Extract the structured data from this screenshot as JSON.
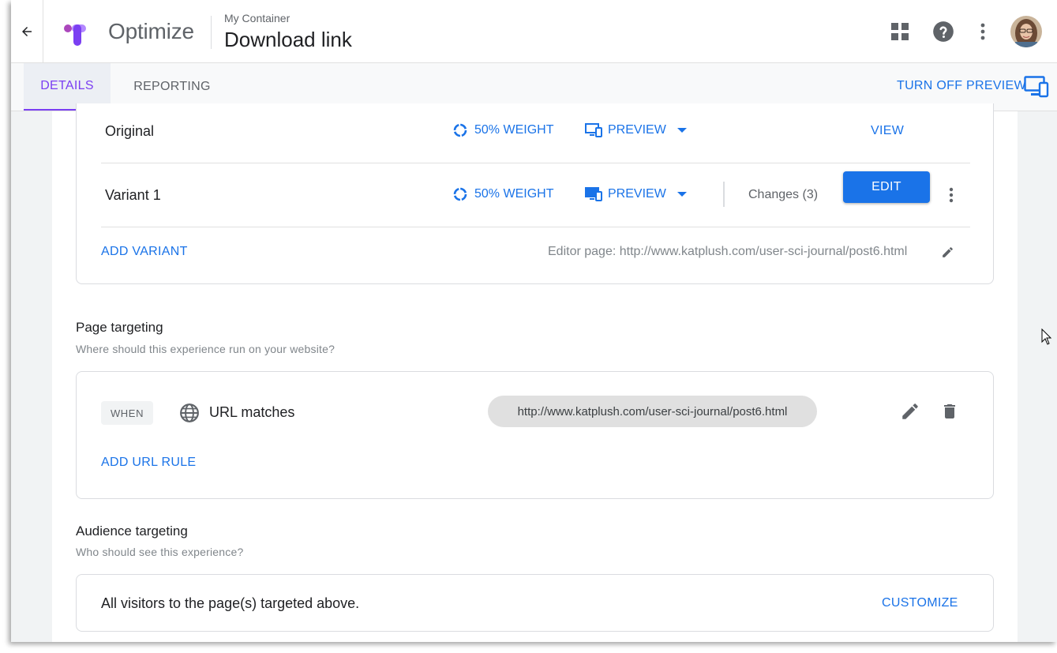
{
  "header": {
    "product_name": "Optimize",
    "container_name": "My Container",
    "experience_name": "Download link",
    "icons": [
      "arrow-back-icon",
      "apps-grid-icon",
      "help-icon",
      "more-vert-icon",
      "avatar"
    ]
  },
  "tabs": [
    {
      "label": "DETAILS",
      "active": true
    },
    {
      "label": "REPORTING",
      "active": false
    }
  ],
  "toolbar": {
    "turn_off_preview": "TURN OFF PREVIEW"
  },
  "variants": {
    "items": [
      {
        "name": "Original",
        "weight": "50% WEIGHT",
        "preview": "PREVIEW",
        "action": "VIEW"
      },
      {
        "name": "Variant 1",
        "weight": "50% WEIGHT",
        "preview": "PREVIEW",
        "changes": "Changes (3)",
        "action": "EDIT"
      }
    ],
    "add_variant": "ADD VARIANT",
    "editor_page": "Editor page: http://www.katplush.com/user-sci-journal/post6.html"
  },
  "page_targeting": {
    "title": "Page targeting",
    "subtitle": "Where should this experience run on your website?",
    "rule": {
      "when": "WHEN",
      "condition": "URL matches",
      "value": "http://www.katplush.com/user-sci-journal/post6.html"
    },
    "add_rule": "ADD URL RULE"
  },
  "audience_targeting": {
    "title": "Audience targeting",
    "subtitle": "Who should see this experience?",
    "summary": "All visitors to the page(s) targeted above.",
    "customize": "CUSTOMIZE"
  },
  "colors": {
    "accent_blue": "#1a73e8",
    "accent_purple": "#7b3ff2"
  }
}
